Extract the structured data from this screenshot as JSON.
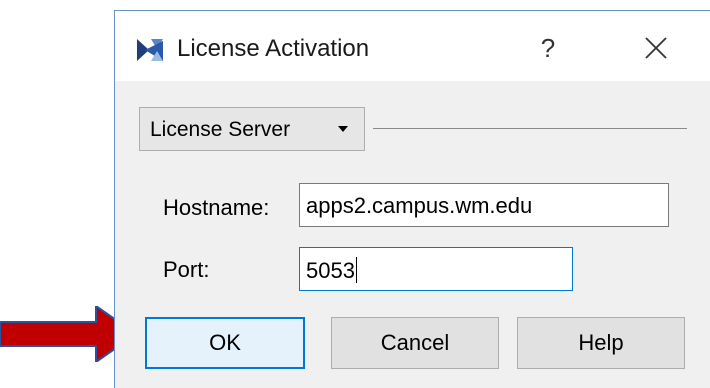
{
  "window": {
    "title": "License Activation",
    "help_glyph": "?",
    "app_icon": "license-app-icon",
    "close_icon": "close-icon"
  },
  "license_type": {
    "selected": "License Server"
  },
  "form": {
    "hostname_label": "Hostname:",
    "hostname_value": "apps2.campus.wm.edu",
    "port_label": "Port:",
    "port_value": "5053"
  },
  "buttons": {
    "ok": "OK",
    "cancel": "Cancel",
    "help": "Help"
  },
  "annotation": {
    "arrow_icon": "pointer-arrow-icon",
    "arrow_color": "#c00000"
  },
  "colors": {
    "focus_accent": "#0078d7",
    "dialog_bg": "#f0f0f0"
  }
}
